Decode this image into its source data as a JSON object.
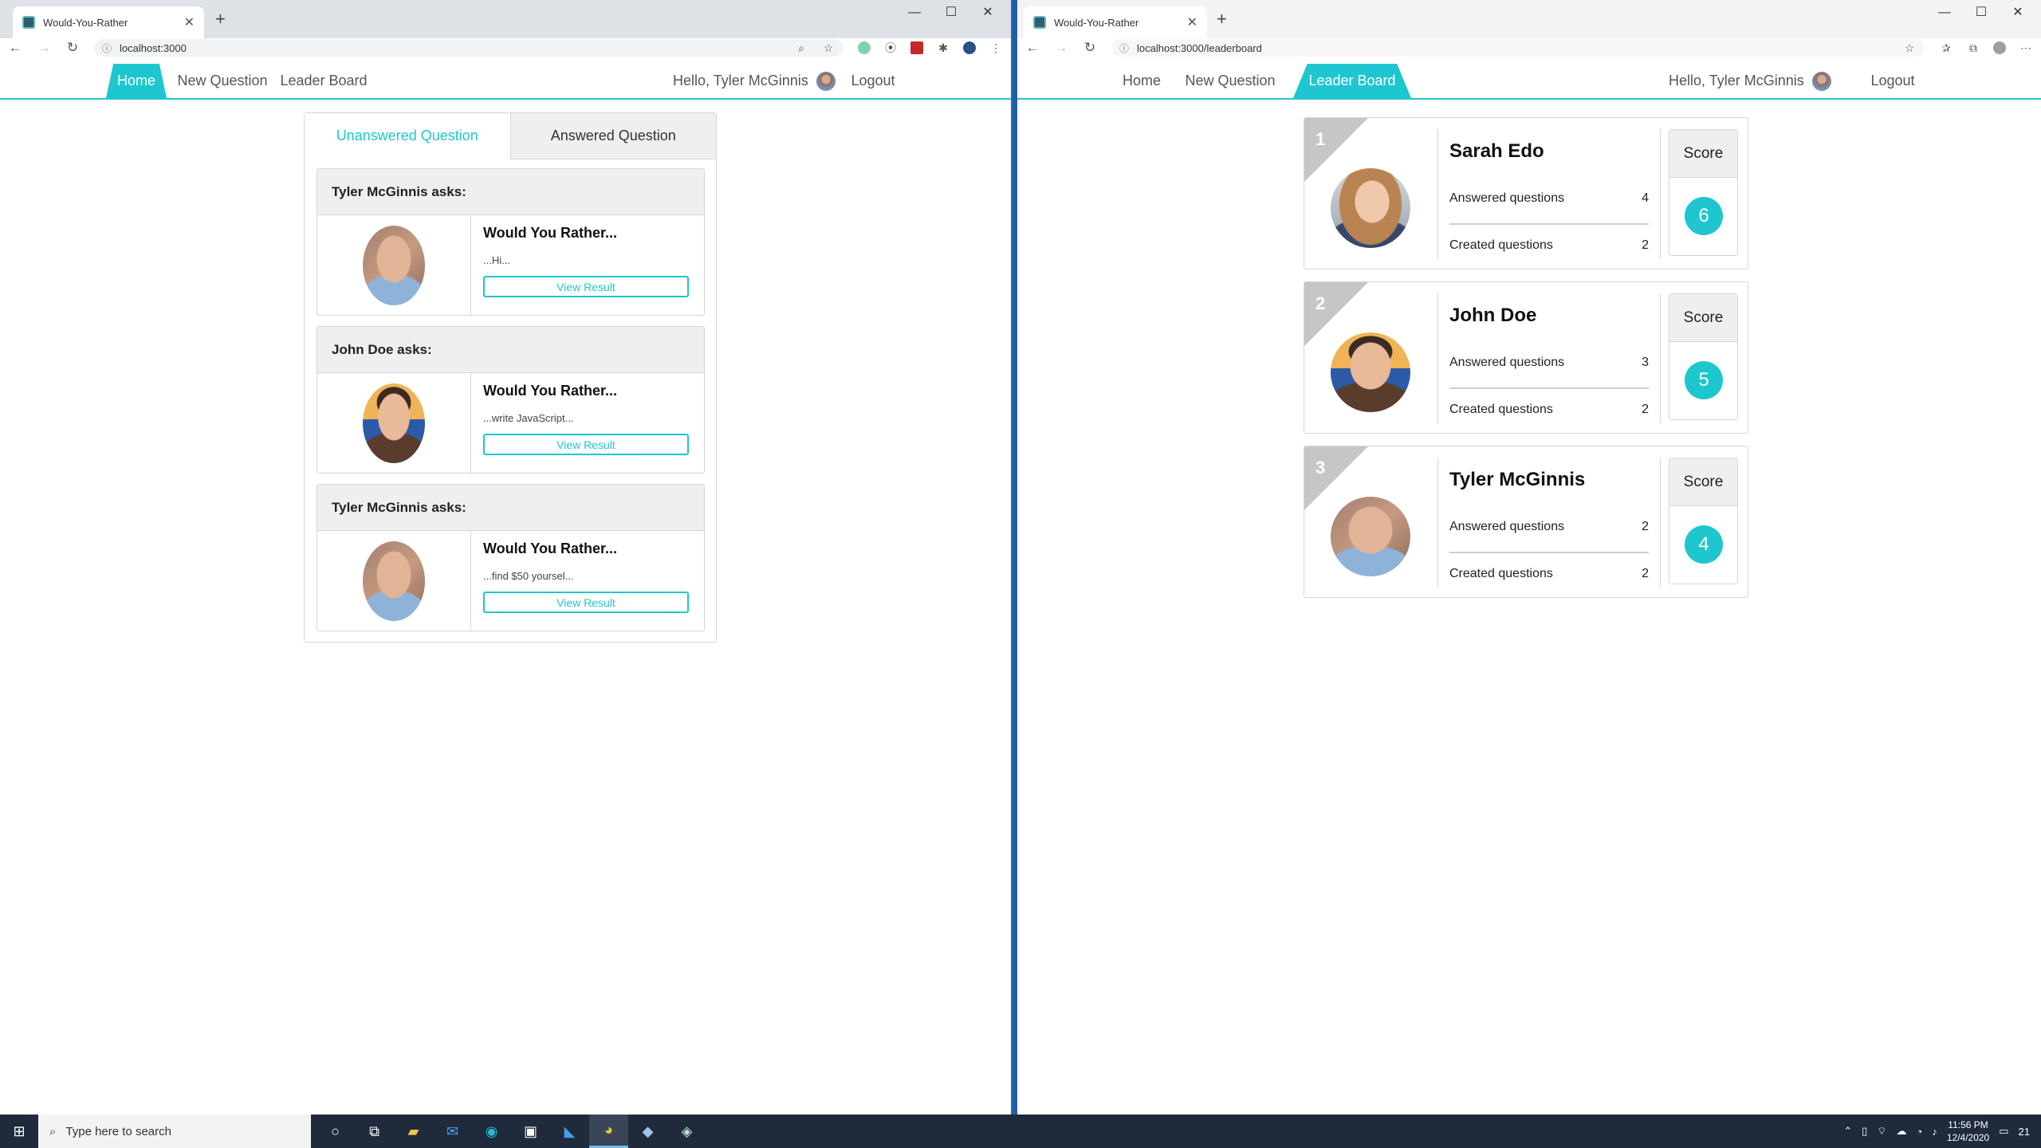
{
  "left_window": {
    "tab_title": "Would-You-Rather",
    "url": "localhost:3000",
    "nav": {
      "home": "Home",
      "new_question": "New Question",
      "leader_board": "Leader Board",
      "greeting": "Hello, Tyler McGinnis",
      "logout": "Logout",
      "active": "Home"
    },
    "question_tabs": {
      "unanswered": "Unanswered Question",
      "answered": "Answered Question",
      "active": "Unanswered Question"
    },
    "questions": [
      {
        "author_line": "Tyler McGinnis asks:",
        "heading": "Would You Rather...",
        "preview": "...Hi...",
        "button": "View Result"
      },
      {
        "author_line": "John Doe asks:",
        "heading": "Would You Rather...",
        "preview": "...write JavaScript...",
        "button": "View Result"
      },
      {
        "author_line": "Tyler McGinnis asks:",
        "heading": "Would You Rather...",
        "preview": "...find $50 yoursel...",
        "button": "View Result"
      }
    ]
  },
  "right_window": {
    "tab_title": "Would-You-Rather",
    "url": "localhost:3000/leaderboard",
    "nav": {
      "home": "Home",
      "new_question": "New Question",
      "leader_board": "Leader Board",
      "greeting": "Hello, Tyler McGinnis",
      "logout": "Logout",
      "active": "Leader Board"
    },
    "leaders": [
      {
        "rank": "1",
        "name": "Sarah Edo",
        "answered_label": "Answered questions",
        "answered": "4",
        "created_label": "Created questions",
        "created": "2",
        "score_label": "Score",
        "score": "6"
      },
      {
        "rank": "2",
        "name": "John Doe",
        "answered_label": "Answered questions",
        "answered": "3",
        "created_label": "Created questions",
        "created": "2",
        "score_label": "Score",
        "score": "5"
      },
      {
        "rank": "3",
        "name": "Tyler McGinnis",
        "answered_label": "Answered questions",
        "answered": "2",
        "created_label": "Created questions",
        "created": "2",
        "score_label": "Score",
        "score": "4"
      }
    ]
  },
  "taskbar": {
    "search_placeholder": "Type here to search",
    "time": "11:56 PM",
    "date": "12/4/2020",
    "notifications": "21"
  },
  "colors": {
    "accent": "#1ec6cf",
    "card_header": "#efefef",
    "border": "#d6d6d6"
  }
}
